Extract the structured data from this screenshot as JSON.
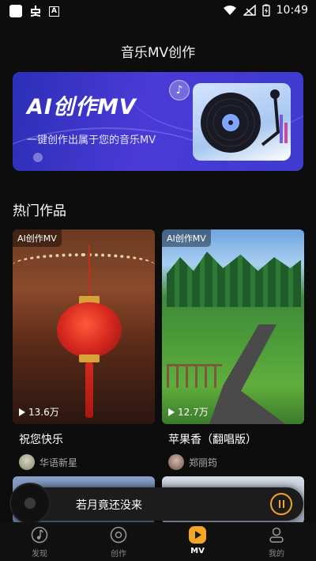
{
  "status_bar": {
    "time": "10:49",
    "battery_glyph": "⚡"
  },
  "header": {
    "title": "音乐MV创作"
  },
  "banner": {
    "title": "AI创作MV",
    "subtitle": "一键创作出属于您的音乐MV"
  },
  "hot_section": {
    "title": "热门作品"
  },
  "works": [
    {
      "badge": "AI创作MV",
      "views": "13.6万",
      "title": "祝您快乐",
      "author": "华语新星"
    },
    {
      "badge": "AI创作MV",
      "views": "12.7万",
      "title": "苹果香（翻唱版）",
      "author": "郑丽筠"
    }
  ],
  "mini_player": {
    "title": "若月竟还没来"
  },
  "nav": [
    {
      "label": "发现",
      "icon": "music-note-icon"
    },
    {
      "label": "创作",
      "icon": "disc-icon"
    },
    {
      "label": "MV",
      "icon": "play-icon"
    },
    {
      "label": "我的",
      "icon": "profile-icon"
    }
  ],
  "colors": {
    "accent": "#f5a623",
    "banner_start": "#2b2fb8",
    "banner_end": "#4b3ad6",
    "background": "#0d0d0d"
  }
}
